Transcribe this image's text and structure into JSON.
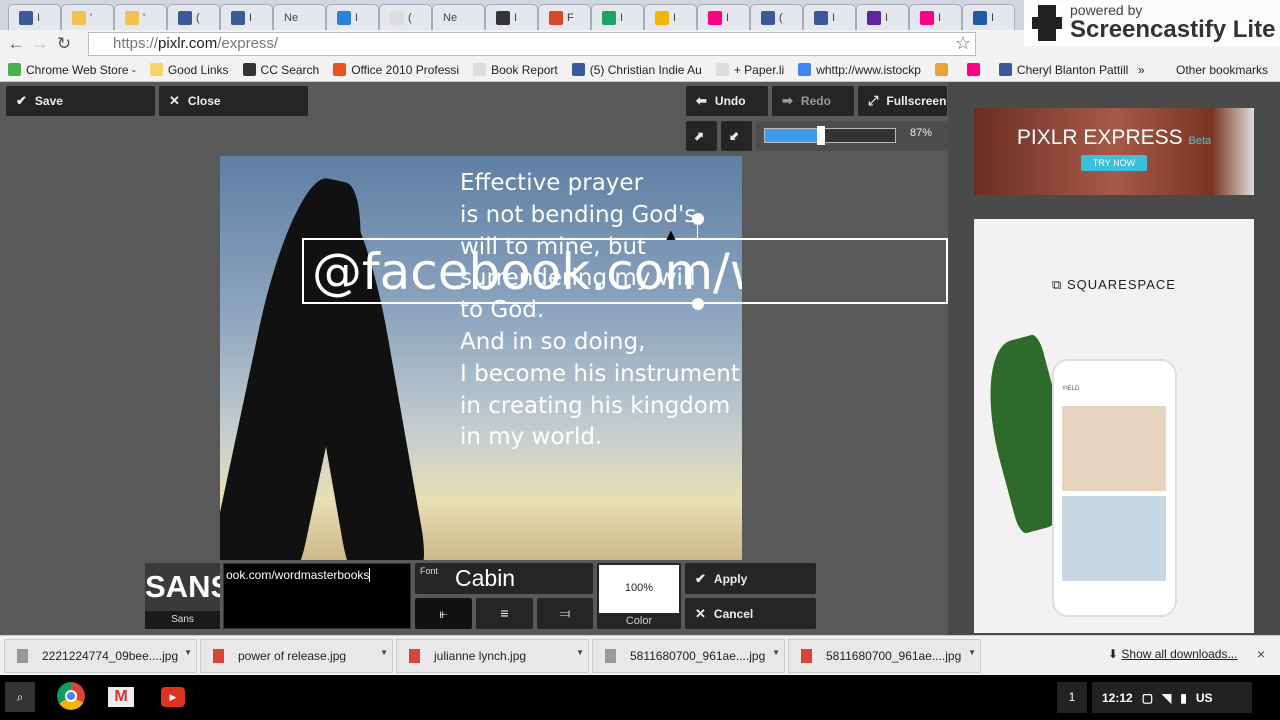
{
  "browser": {
    "tabs": [
      {
        "icon": "facebook-icon",
        "label": "I",
        "color": "#3b5998"
      },
      {
        "icon": "circle-icon",
        "label": "'",
        "color": "#f2c14e"
      },
      {
        "icon": "circle-icon",
        "label": "'",
        "color": "#f2c14e"
      },
      {
        "icon": "facebook-icon",
        "label": "(",
        "color": "#3b5998"
      },
      {
        "icon": "facebook-icon",
        "label": "I",
        "color": "#3b5998"
      },
      {
        "icon": "none",
        "label": "Ne",
        "color": ""
      },
      {
        "icon": "dropbox-icon",
        "label": "I",
        "color": "#2a7fd8"
      },
      {
        "icon": "document-icon",
        "label": "(",
        "color": "#ddd"
      },
      {
        "icon": "none",
        "label": "Ne",
        "color": ""
      },
      {
        "icon": "film-icon",
        "label": "I",
        "color": "#333"
      },
      {
        "icon": "office-icon",
        "label": "F",
        "color": "#d9472b"
      },
      {
        "icon": "drive-icon",
        "label": "I",
        "color": "#1fa463"
      },
      {
        "icon": "slides-icon",
        "label": "I",
        "color": "#f4b400"
      },
      {
        "icon": "flickr-icon",
        "label": "I",
        "color": "#ff0084"
      },
      {
        "icon": "facebook-icon",
        "label": "(",
        "color": "#3b5998"
      },
      {
        "icon": "facebook-icon",
        "label": "I",
        "color": "#3b5998"
      },
      {
        "icon": "yahoo-icon",
        "label": "I",
        "color": "#5f259f"
      },
      {
        "icon": "flickr-icon",
        "label": "I",
        "color": "#ff0084"
      },
      {
        "icon": "cloud-icon",
        "label": "I",
        "color": "#1e5aa8"
      }
    ],
    "url_scheme": "https://",
    "url_host": "pixlr.com",
    "url_path": "/express/",
    "bookmarks": [
      {
        "label": "Chrome Web Store -",
        "color": "#4caf50"
      },
      {
        "label": "Good Links",
        "color": "#f6d36b"
      },
      {
        "label": "CC Search",
        "color": "#333"
      },
      {
        "label": "Office 2010 Professi",
        "color": "#e8531e"
      },
      {
        "label": "Book Report",
        "color": "#ddd"
      },
      {
        "label": "(5) Christian Indie Au",
        "color": "#3b5998"
      },
      {
        "label": "+ Paper.li",
        "color": "#ddd"
      },
      {
        "label": "whttp://www.istockp",
        "color": "#4285f4"
      },
      {
        "label": "",
        "color": "#e8a33c"
      },
      {
        "label": "",
        "color": "#ff0084"
      },
      {
        "label": "Cheryl Blanton Pattill",
        "color": "#3b5998"
      }
    ],
    "bookmarks_more": "»",
    "other_bookmarks": "Other bookmarks"
  },
  "watermark": {
    "line1": "powered by",
    "line2": "Screencastify Lite"
  },
  "editor": {
    "save": "Save",
    "close": "Close",
    "undo": "Undo",
    "redo": "Redo",
    "fullscreen": "Fullscreen",
    "zoom_percent": 87,
    "zoom_label": "87%",
    "quote": "Effective prayer\nis not bending God's\nwill to mine, but\nsurrendering my will\nto God.\nAnd in so doing,\nI become his instrument\nin creating his kingdom\nin my world.",
    "overlay_text": "@facebook.com/wordmasterbooks",
    "text_toolbar": {
      "font_preview": "SANS",
      "font_category": "Sans",
      "text_value": "ook.com/wordmasterbooks",
      "font_label": "Font",
      "font_name": "Cabin",
      "opacity": "100%",
      "color_label": "Color",
      "apply": "Apply",
      "cancel": "Cancel"
    }
  },
  "ads": {
    "pixlr_title": "PIXLR",
    "pixlr_title2": "EXPRESS",
    "pixlr_beta": "Beta",
    "pixlr_cta": "TRY NOW",
    "squarespace": "SQUARESPACE",
    "yield": "YIELD"
  },
  "downloads": {
    "items": [
      {
        "name": "2221224774_09bee....jpg",
        "icon": "file-icon"
      },
      {
        "name": "power of release.jpg",
        "icon": "image-icon"
      },
      {
        "name": "julianne lynch.jpg",
        "icon": "image-icon"
      },
      {
        "name": "5811680700_961ae....jpg",
        "icon": "file-icon"
      },
      {
        "name": "5811680700_961ae....jpg",
        "icon": "image-icon"
      }
    ],
    "show_all": "Show all downloads...",
    "close": "×"
  },
  "shelf": {
    "window_count": "1",
    "time": "12:12",
    "locale": "US"
  }
}
